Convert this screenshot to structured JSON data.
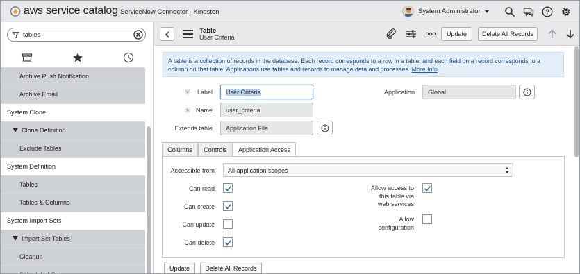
{
  "header": {
    "logo_text": "aws service catalog",
    "instance": "ServiceNow Connector - Kingston",
    "user_name": "System Administrator",
    "icons": [
      "search-icon",
      "chat-icon",
      "help-icon",
      "gear-icon"
    ]
  },
  "nav": {
    "filter_value": "tables",
    "tab_icons": [
      "archive-icon",
      "star-icon",
      "clock-icon"
    ],
    "items": [
      {
        "label": "Archive Push Notification",
        "kind": "module"
      },
      {
        "label": "Archive Email",
        "kind": "module"
      },
      {
        "label": "System Clone",
        "kind": "app"
      },
      {
        "label": "Clone Definition",
        "kind": "section"
      },
      {
        "label": "Exclude Tables",
        "kind": "module"
      },
      {
        "label": "System Definition",
        "kind": "app"
      },
      {
        "label": "Tables",
        "kind": "module"
      },
      {
        "label": "Tables & Columns",
        "kind": "module"
      },
      {
        "label": "System Import Sets",
        "kind": "app"
      },
      {
        "label": "Import Set Tables",
        "kind": "section"
      },
      {
        "label": "Cleanup",
        "kind": "module"
      },
      {
        "label": "Scheduled Cleanup",
        "kind": "module"
      }
    ]
  },
  "content_header": {
    "title": "Table",
    "subtitle": "User Criteria",
    "update_label": "Update",
    "delete_all_label": "Delete All Records"
  },
  "info": {
    "text": "A table is a collection of records in the database. Each record corresponds to a row in a table, and each field on a record corresponds to a column on that table. Applications use tables and records to manage data and processes.",
    "link": "More Info"
  },
  "form": {
    "label_label": "Label",
    "label_value": "User Criteria",
    "name_label": "Name",
    "name_value": "user_criteria",
    "extends_label": "Extends table",
    "extends_value": "Application File",
    "application_label": "Application",
    "application_value": "Global"
  },
  "tabs": [
    "Columns",
    "Controls",
    "Application Access"
  ],
  "access": {
    "accessible_from_label": "Accessible from",
    "accessible_from_value": "All application scopes",
    "can_read_label": "Can read",
    "can_read": true,
    "can_create_label": "Can create",
    "can_create": true,
    "can_update_label": "Can update",
    "can_update": false,
    "can_delete_label": "Can delete",
    "can_delete": true,
    "web_access_label_1": "Allow access to",
    "web_access_label_2": "this table via",
    "web_access_label_3": "web services",
    "web_access": true,
    "allow_config_label_1": "Allow",
    "allow_config_label_2": "configuration",
    "allow_config": false
  },
  "footer": {
    "update_label": "Update",
    "delete_all_label": "Delete All Records"
  },
  "colors": {
    "accent": "#5b9bd5",
    "info_bg": "#e3eef8",
    "check": "#2d6fb7"
  }
}
